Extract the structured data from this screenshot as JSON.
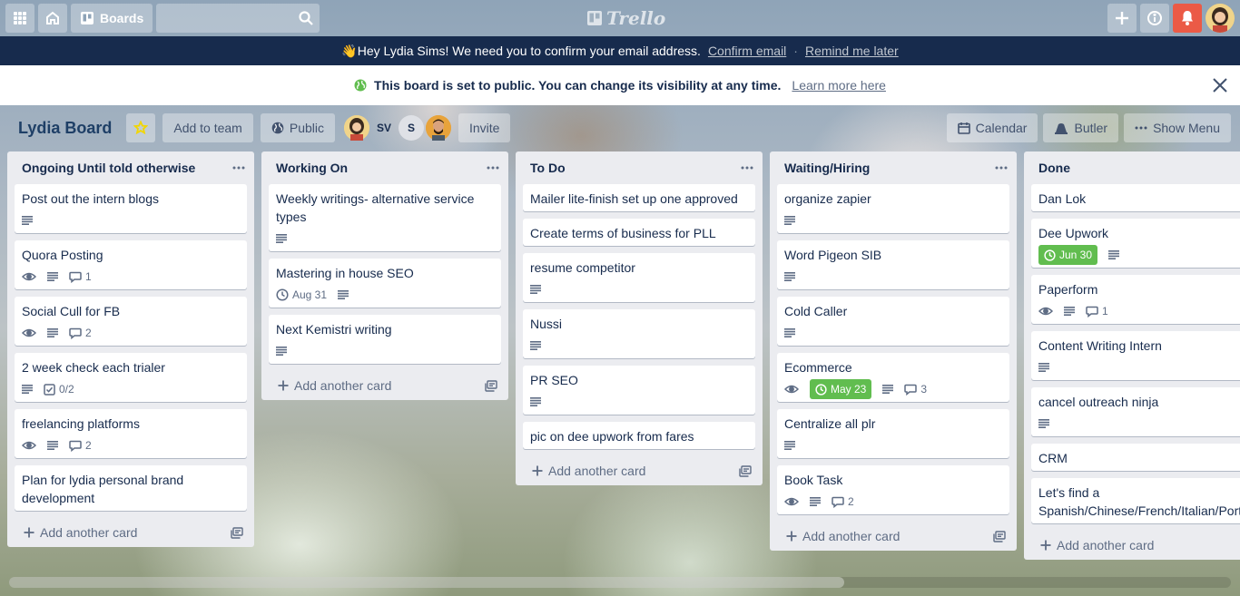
{
  "header": {
    "boards_label": "Boards",
    "logo_text": "Trello"
  },
  "email_banner": {
    "message": "👋Hey Lydia Sims! We need you to confirm your email address.",
    "confirm_link": "Confirm email",
    "separator": "·",
    "remind_link": "Remind me later"
  },
  "public_banner": {
    "message": "This board is set to public. You can change its visibility at any time.",
    "learn_link": "Learn more here"
  },
  "board": {
    "name": "Lydia Board",
    "add_to_team": "Add to team",
    "visibility": "Public",
    "members": [
      "SV",
      "S"
    ],
    "invite": "Invite",
    "calendar": "Calendar",
    "butler": "Butler",
    "show_menu": "Show Menu"
  },
  "colors": {
    "due_green": "#61bd4f",
    "notification_red": "#eb5a46",
    "banner_navy": "#172b4d",
    "board_title": "#1e3f66",
    "list_bg": "#ebecf0"
  },
  "add_card_label": "Add another card",
  "lists": [
    {
      "title": "Ongoing Until told otherwise",
      "cards": [
        {
          "title": "Post out the intern blogs",
          "badges": {
            "desc": true
          }
        },
        {
          "title": "Quora Posting",
          "badges": {
            "watch": true,
            "desc": true,
            "comments": "1"
          }
        },
        {
          "title": "Social Cull for FB",
          "badges": {
            "watch": true,
            "desc": true,
            "comments": "2"
          }
        },
        {
          "title": "2 week check each trialer",
          "badges": {
            "desc": true,
            "checklist": "0/2"
          }
        },
        {
          "title": "freelancing platforms",
          "badges": {
            "watch": true,
            "desc": true,
            "comments": "2"
          }
        },
        {
          "title": "Plan for lydia personal brand development",
          "badges": {}
        }
      ]
    },
    {
      "title": "Working On",
      "cards": [
        {
          "title": "Weekly writings- alternative service types",
          "badges": {
            "desc": true
          }
        },
        {
          "title": "Mastering in house SEO",
          "badges": {
            "due": "Aug 31",
            "desc": true
          }
        },
        {
          "title": "Next Kemistri writing",
          "badges": {
            "desc": true
          }
        }
      ]
    },
    {
      "title": "To Do",
      "cards": [
        {
          "title": "Mailer lite-finish set up one approved",
          "badges": {}
        },
        {
          "title": "Create terms of business for PLL",
          "badges": {}
        },
        {
          "title": "resume competitor",
          "badges": {
            "desc": true
          }
        },
        {
          "title": "Nussi",
          "badges": {
            "desc": true
          }
        },
        {
          "title": "PR SEO",
          "badges": {
            "desc": true
          }
        },
        {
          "title": "pic on dee upwork from fares",
          "badges": {}
        }
      ]
    },
    {
      "title": "Waiting/Hiring",
      "cards": [
        {
          "title": "organize zapier",
          "badges": {
            "desc": true
          }
        },
        {
          "title": "Word Pigeon SIB",
          "badges": {
            "desc": true
          }
        },
        {
          "title": "Cold Caller",
          "badges": {
            "desc": true
          }
        },
        {
          "title": "Ecommerce",
          "badges": {
            "watch": true,
            "due_complete": "May 23",
            "desc": true,
            "comments": "3"
          }
        },
        {
          "title": "Centralize all plr",
          "badges": {
            "desc": true
          }
        },
        {
          "title": "Book Task",
          "badges": {
            "watch": true,
            "desc": true,
            "comments": "2"
          }
        }
      ]
    },
    {
      "title": "Done",
      "cards": [
        {
          "title": "Dan Lok",
          "badges": {}
        },
        {
          "title": "Dee Upwork",
          "badges": {
            "due_complete": "Jun 30",
            "desc": true
          }
        },
        {
          "title": "Paperform",
          "badges": {
            "watch": true,
            "desc": true,
            "comments": "1"
          }
        },
        {
          "title": "Content Writing Intern",
          "badges": {
            "desc": true
          }
        },
        {
          "title": "cancel outreach ninja",
          "badges": {
            "desc": true
          }
        },
        {
          "title": "CRM",
          "badges": {}
        },
        {
          "title": "Let's find a Spanish/Chinese/French/Italian/Portuguese",
          "badges": {}
        }
      ]
    }
  ]
}
